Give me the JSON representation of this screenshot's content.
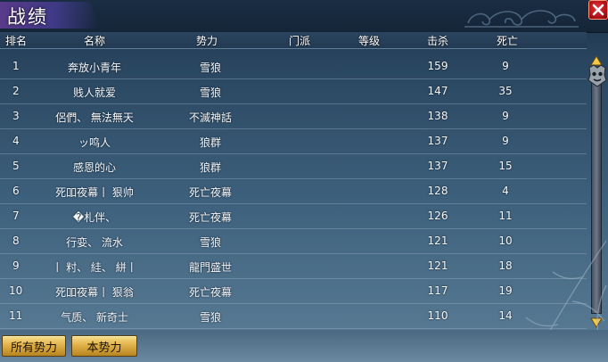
{
  "window": {
    "title": "战绩"
  },
  "table": {
    "headers": {
      "rank": "排名",
      "name": "名称",
      "faction": "势力",
      "sect": "门派",
      "level": "等级",
      "kills": "击杀",
      "deaths": "死亡"
    },
    "rows": [
      {
        "rank": "1",
        "name": "奔放小青年",
        "faction": "雪狼",
        "sect": "",
        "level": "",
        "kills": "159",
        "deaths": "9"
      },
      {
        "rank": "2",
        "name": "贱人就爱",
        "faction": "雪狼",
        "sect": "",
        "level": "",
        "kills": "147",
        "deaths": "35"
      },
      {
        "rank": "3",
        "name": "侶們、 無法無天",
        "faction": "不滅神話",
        "sect": "",
        "level": "",
        "kills": "138",
        "deaths": "9"
      },
      {
        "rank": "4",
        "name": "ッ鸣人",
        "faction": "狼群",
        "sect": "",
        "level": "",
        "kills": "137",
        "deaths": "9"
      },
      {
        "rank": "5",
        "name": "感恩的心",
        "faction": "狼群",
        "sect": "",
        "level": "",
        "kills": "137",
        "deaths": "15"
      },
      {
        "rank": "6",
        "name": "死吅夜幕丨 狠帅",
        "faction": "死亡夜幕",
        "sect": "",
        "level": "",
        "kills": "128",
        "deaths": "4"
      },
      {
        "rank": "7",
        "name": "�札伴、",
        "faction": "死亡夜幕",
        "sect": "",
        "level": "",
        "kills": "126",
        "deaths": "11"
      },
      {
        "rank": "8",
        "name": "行娈、 流水",
        "faction": "雪狼",
        "sect": "",
        "level": "",
        "kills": "121",
        "deaths": "10"
      },
      {
        "rank": "9",
        "name": "丨 籿、 絓、 絣丨",
        "faction": "龍門盛世",
        "sect": "",
        "level": "",
        "kills": "121",
        "deaths": "18"
      },
      {
        "rank": "10",
        "name": "死吅夜幕丨 狠翁",
        "faction": "死亡夜幕",
        "sect": "",
        "level": "",
        "kills": "117",
        "deaths": "19"
      },
      {
        "rank": "11",
        "name": "气质、 新奇士",
        "faction": "雪狼",
        "sect": "",
        "level": "",
        "kills": "110",
        "deaths": "14"
      }
    ]
  },
  "tabs": {
    "all": "所有势力",
    "own": "本势力"
  },
  "icons": {
    "close": "close-icon",
    "scroll_up": "arrow-up-icon",
    "scroll_down": "arrow-down-icon",
    "thumb": "ornament-thumb-icon"
  },
  "colors": {
    "title_accent": "#5a3a8a",
    "close_red": "#c8191f",
    "tab_gold": "#e2b24a",
    "panel_blue": "#3d607c"
  }
}
